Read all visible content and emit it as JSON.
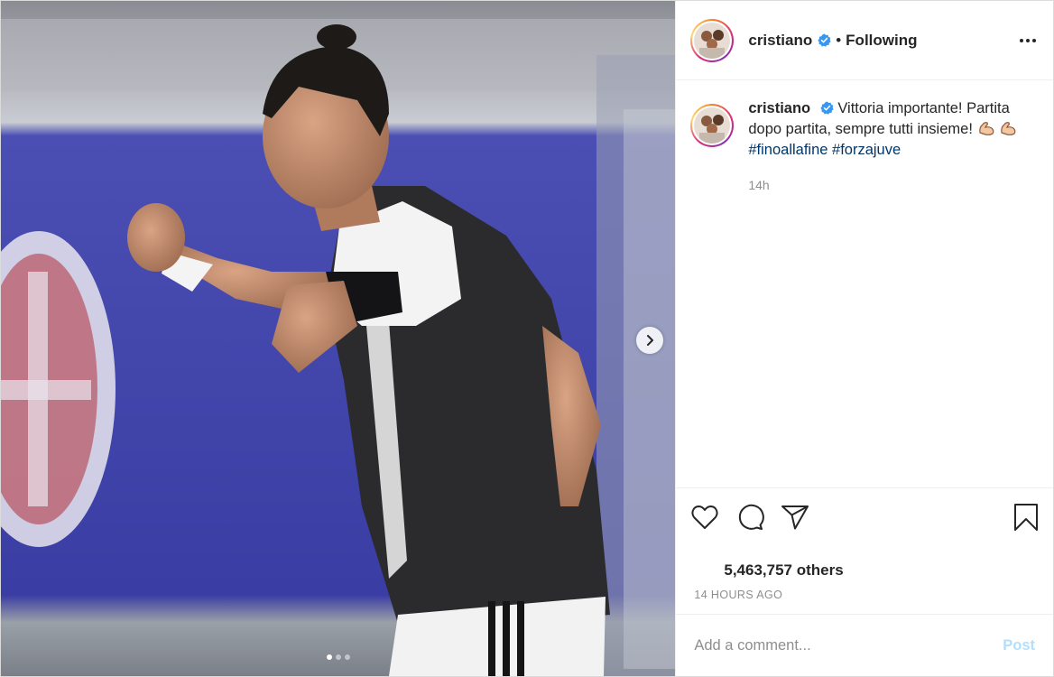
{
  "post": {
    "author": {
      "username": "cristiano",
      "verified": true,
      "follow_status": "Following",
      "bullet": "•"
    },
    "caption": {
      "username": "cristiano",
      "text_1": "Vittoria importante! Partita dopo partita, sempre tutti insieme!",
      "emoji": "flexed-biceps",
      "hashtags": [
        "#finoallafine",
        "#forzajuve"
      ],
      "posted_ago": "14h"
    },
    "likes": "5,463,757 others",
    "timestamp": "14 HOURS AGO",
    "comment": {
      "placeholder": "Add a comment...",
      "value": "",
      "post_label": "Post"
    },
    "carousel": {
      "total": 3,
      "current": 1
    }
  },
  "icons": {
    "more": "more-horizontal-icon",
    "next": "chevron-right-icon",
    "like": "heart-icon",
    "comment": "comment-bubble-icon",
    "share": "paper-plane-icon",
    "save": "bookmark-icon",
    "verified": "verified-badge-icon"
  },
  "colors": {
    "verified": "#3897f0",
    "hashtag": "#00376b",
    "post_button_disabled": "#b2dffc",
    "secondary_text": "#8e8e8e"
  }
}
